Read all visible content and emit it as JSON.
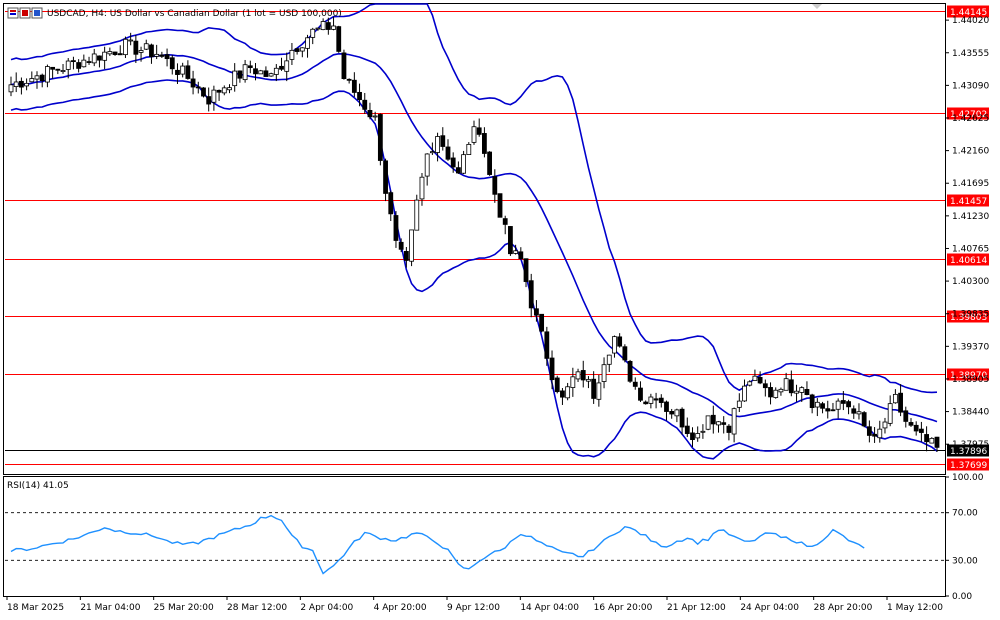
{
  "window": {
    "symbol_line": "USDCAD, H4:  US Dollar vs Canadian Dollar (1 lot = USD 100,000)"
  },
  "colors": {
    "bull": "#ffffff",
    "bear": "#000000",
    "bands": "#0000cc",
    "rsi": "#1e90ff",
    "level": "#ff0000",
    "price_line": "#000000"
  },
  "chart_data": [
    {
      "type": "candlestick",
      "title": "USDCAD, H4:  US Dollar vs Canadian Dollar (1 lot = USD 100,000)",
      "ylim": [
        1.3755,
        1.4425
      ],
      "y_ticks": [
        "1.44020",
        "1.43555",
        "1.43090",
        "1.42625",
        "1.42160",
        "1.41695",
        "1.41230",
        "1.40765",
        "1.40300",
        "1.39835",
        "1.39370",
        "1.38905",
        "1.38440",
        "1.37975"
      ],
      "x_ticks": [
        "18 Mar 2025",
        "21 Mar 04:00",
        "25 Mar 20:00",
        "28 Mar 12:00",
        "2 Apr 04:00",
        "4 Apr 20:00",
        "9 Apr 12:00",
        "14 Apr 04:00",
        "16 Apr 20:00",
        "21 Apr 12:00",
        "24 Apr 04:00",
        "28 Apr 20:00",
        "1 May 12:00"
      ],
      "horizontal_levels": [
        "1.44145",
        "1.42702",
        "1.41457",
        "1.40614",
        "1.39803",
        "1.38970",
        "1.37699"
      ],
      "current_price": "1.37896",
      "indicators": [
        "Bollinger Bands"
      ],
      "close_path": [
        [
          0,
          1.431
        ],
        [
          8,
          1.433
        ],
        [
          16,
          1.435
        ],
        [
          22,
          1.4365
        ],
        [
          28,
          1.4355
        ],
        [
          34,
          1.432
        ],
        [
          38,
          1.429
        ],
        [
          42,
          1.4315
        ],
        [
          46,
          1.4335
        ],
        [
          50,
          1.432
        ],
        [
          54,
          1.436
        ],
        [
          58,
          1.4385
        ],
        [
          62,
          1.4395
        ],
        [
          64,
          1.432
        ],
        [
          66,
          1.43
        ],
        [
          68,
          1.428
        ],
        [
          70,
          1.426
        ],
        [
          72,
          1.416
        ],
        [
          74,
          1.408
        ],
        [
          76,
          1.405
        ],
        [
          78,
          1.414
        ],
        [
          80,
          1.421
        ],
        [
          82,
          1.424
        ],
        [
          84,
          1.421
        ],
        [
          86,
          1.418
        ],
        [
          88,
          1.423
        ],
        [
          90,
          1.425
        ],
        [
          92,
          1.418
        ],
        [
          94,
          1.413
        ],
        [
          96,
          1.407
        ],
        [
          98,
          1.406
        ],
        [
          100,
          1.4
        ],
        [
          102,
          1.395
        ],
        [
          104,
          1.39
        ],
        [
          106,
          1.386
        ],
        [
          108,
          1.389
        ],
        [
          110,
          1.3895
        ],
        [
          112,
          1.387
        ],
        [
          114,
          1.392
        ],
        [
          116,
          1.395
        ],
        [
          118,
          1.391
        ],
        [
          120,
          1.388
        ],
        [
          122,
          1.386
        ],
        [
          124,
          1.387
        ],
        [
          126,
          1.385
        ],
        [
          128,
          1.384
        ],
        [
          130,
          1.382
        ],
        [
          132,
          1.381
        ],
        [
          134,
          1.384
        ],
        [
          136,
          1.383
        ],
        [
          138,
          1.3825
        ],
        [
          140,
          1.386
        ],
        [
          142,
          1.389
        ],
        [
          144,
          1.388
        ],
        [
          146,
          1.387
        ],
        [
          148,
          1.3885
        ],
        [
          150,
          1.388
        ],
        [
          152,
          1.3885
        ],
        [
          154,
          1.386
        ],
        [
          156,
          1.385
        ],
        [
          158,
          1.3845
        ],
        [
          160,
          1.3855
        ],
        [
          162,
          1.385
        ],
        [
          164,
          1.382
        ],
        [
          166,
          1.38
        ],
        [
          168,
          1.383
        ],
        [
          170,
          1.386
        ],
        [
          172,
          1.383
        ],
        [
          174,
          1.381
        ],
        [
          176,
          1.38
        ],
        [
          178,
          1.379
        ]
      ]
    },
    {
      "type": "line",
      "title": "RSI(14) 41.05",
      "ylim": [
        0,
        100
      ],
      "y_ticks": [
        "100.00",
        "70.00",
        "30.00",
        "0.00"
      ],
      "levels": [
        70,
        30
      ],
      "path": [
        [
          0,
          38
        ],
        [
          4,
          40
        ],
        [
          8,
          44
        ],
        [
          12,
          48
        ],
        [
          16,
          54
        ],
        [
          18,
          58
        ],
        [
          20,
          55
        ],
        [
          24,
          53
        ],
        [
          28,
          50
        ],
        [
          30,
          46
        ],
        [
          32,
          44
        ],
        [
          34,
          43
        ],
        [
          36,
          45
        ],
        [
          38,
          48
        ],
        [
          40,
          51
        ],
        [
          42,
          54
        ],
        [
          44,
          57
        ],
        [
          46,
          60
        ],
        [
          48,
          65
        ],
        [
          50,
          68
        ],
        [
          52,
          64
        ],
        [
          54,
          50
        ],
        [
          56,
          42
        ],
        [
          58,
          38
        ],
        [
          60,
          20
        ],
        [
          62,
          25
        ],
        [
          64,
          35
        ],
        [
          66,
          45
        ],
        [
          68,
          53
        ],
        [
          70,
          50
        ],
        [
          72,
          48
        ],
        [
          74,
          47
        ],
        [
          76,
          50
        ],
        [
          78,
          53
        ],
        [
          80,
          49
        ],
        [
          82,
          45
        ],
        [
          84,
          38
        ],
        [
          86,
          26
        ],
        [
          88,
          22
        ],
        [
          90,
          30
        ],
        [
          92,
          35
        ],
        [
          94,
          38
        ],
        [
          96,
          45
        ],
        [
          98,
          53
        ],
        [
          100,
          49
        ],
        [
          102,
          44
        ],
        [
          104,
          40
        ],
        [
          106,
          36
        ],
        [
          108,
          35
        ],
        [
          110,
          33
        ],
        [
          112,
          40
        ],
        [
          114,
          46
        ],
        [
          116,
          53
        ],
        [
          118,
          58
        ],
        [
          120,
          55
        ],
        [
          122,
          50
        ],
        [
          124,
          44
        ],
        [
          126,
          42
        ],
        [
          128,
          46
        ],
        [
          130,
          49
        ],
        [
          132,
          45
        ],
        [
          134,
          48
        ],
        [
          136,
          56
        ],
        [
          138,
          52
        ],
        [
          140,
          47
        ],
        [
          142,
          45
        ],
        [
          144,
          50
        ],
        [
          146,
          53
        ],
        [
          148,
          49
        ],
        [
          150,
          48
        ],
        [
          152,
          44
        ],
        [
          154,
          41
        ],
        [
          156,
          48
        ],
        [
          158,
          55
        ],
        [
          160,
          50
        ],
        [
          162,
          44
        ],
        [
          164,
          41
        ]
      ]
    }
  ]
}
